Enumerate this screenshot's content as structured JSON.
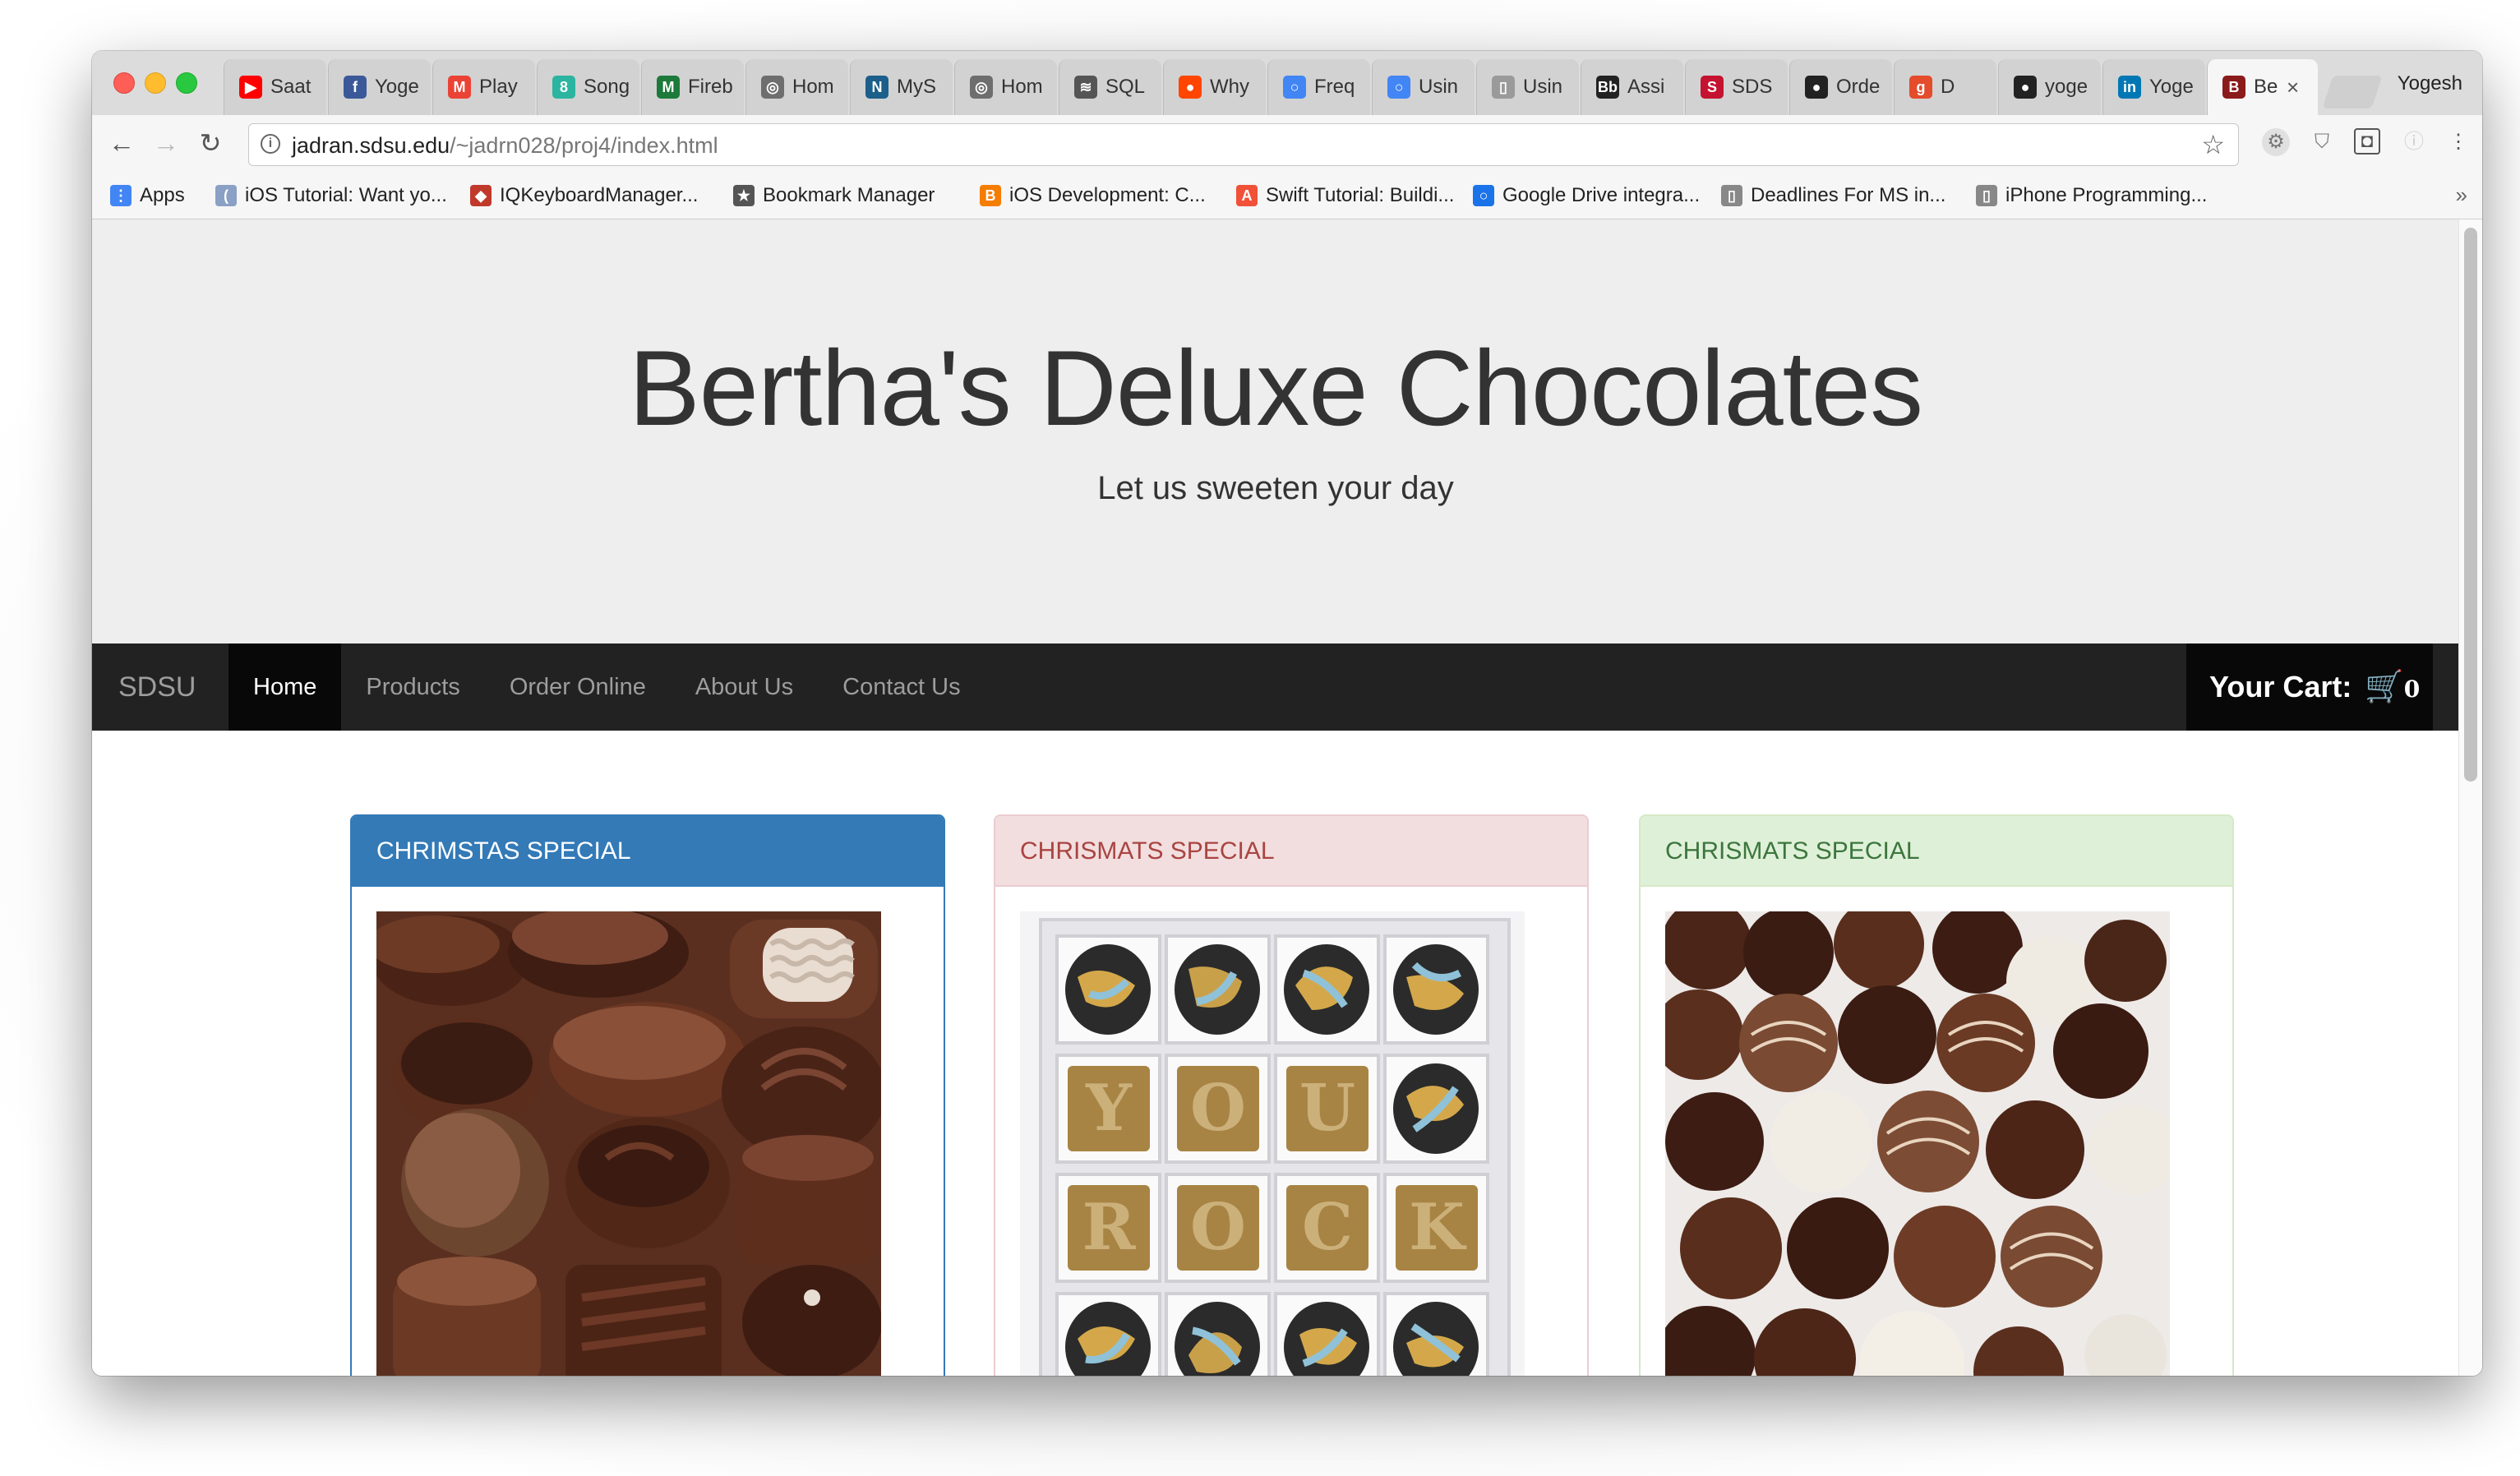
{
  "browser": {
    "profile_name": "Yogesh",
    "tabs": [
      {
        "label": "Saat",
        "icon": "youtube-icon",
        "color": "#ff0000",
        "glyph": "▶"
      },
      {
        "label": "Yoge",
        "icon": "facebook-icon",
        "color": "#3b5998",
        "glyph": "f"
      },
      {
        "label": "Play",
        "icon": "gmail-icon",
        "color": "#ea4335",
        "glyph": "M"
      },
      {
        "label": "Song",
        "icon": "song-icon",
        "color": "#2bb5a0",
        "glyph": "8"
      },
      {
        "label": "Fireb",
        "icon": "firebase-icon",
        "color": "#1d7a3a",
        "glyph": "M"
      },
      {
        "label": "Hom",
        "icon": "github-octocat-icon",
        "color": "#6e6e6e",
        "glyph": "◎"
      },
      {
        "label": "MyS",
        "icon": "mysql-icon",
        "color": "#1b5f8a",
        "glyph": "N"
      },
      {
        "label": "Hom",
        "icon": "gear-icon",
        "color": "#6e6e6e",
        "glyph": "◎"
      },
      {
        "label": "SQL",
        "icon": "stack-icon",
        "color": "#555555",
        "glyph": "≋"
      },
      {
        "label": "Why",
        "icon": "reddit-icon",
        "color": "#ff4500",
        "glyph": "●"
      },
      {
        "label": "Freq",
        "icon": "google-icon",
        "color": "#4285f4",
        "glyph": "○"
      },
      {
        "label": "Usin",
        "icon": "google-icon",
        "color": "#4285f4",
        "glyph": "○"
      },
      {
        "label": "Usin",
        "icon": "document-icon",
        "color": "#9a9a9a",
        "glyph": "▯"
      },
      {
        "label": "Assi",
        "icon": "bb-icon",
        "color": "#222222",
        "glyph": "Bb"
      },
      {
        "label": "SDS",
        "icon": "sdsu-icon",
        "color": "#c41230",
        "glyph": "S"
      },
      {
        "label": "Orde",
        "icon": "github-icon",
        "color": "#222222",
        "glyph": "●"
      },
      {
        "label": "D",
        "icon": "g-icon",
        "color": "#e44c2c",
        "glyph": "g"
      },
      {
        "label": "yoge",
        "icon": "github-icon",
        "color": "#222222",
        "glyph": "●"
      },
      {
        "label": "Yoge",
        "icon": "linkedin-icon",
        "color": "#0077b5",
        "glyph": "in"
      },
      {
        "label": "Be",
        "icon": "bertha-icon",
        "color": "#8b1a1a",
        "glyph": "B"
      }
    ],
    "url_host": "jadran.sdsu.edu",
    "url_path": "/~jadrn028/proj4/index.html",
    "bookmarks": [
      {
        "label": "Apps",
        "icon": "apps-grid-icon",
        "color": "#4285f4",
        "glyph": "⋮"
      },
      {
        "label": "iOS Tutorial: Want yo...",
        "icon": "ios-tutorial-icon",
        "color": "#8aa0c4",
        "glyph": "("
      },
      {
        "label": "IQKeyboardManager...",
        "icon": "iqkeyboard-icon",
        "color": "#c0392b",
        "glyph": "◆"
      },
      {
        "label": "Bookmark Manager",
        "icon": "star-icon",
        "color": "#555555",
        "glyph": "★"
      },
      {
        "label": "iOS Development: C...",
        "icon": "blogger-icon",
        "color": "#f57d00",
        "glyph": "B"
      },
      {
        "label": "Swift Tutorial: Buildi...",
        "icon": "swift-icon",
        "color": "#f05138",
        "glyph": "A"
      },
      {
        "label": "Google Drive integra...",
        "icon": "circle-icon",
        "color": "#1a73e8",
        "glyph": "○"
      },
      {
        "label": "Deadlines For MS in...",
        "icon": "document-icon",
        "color": "#888888",
        "glyph": "▯"
      },
      {
        "label": "iPhone Programming...",
        "icon": "document-icon",
        "color": "#888888",
        "glyph": "▯"
      }
    ]
  },
  "site": {
    "title": "Bertha's Deluxe Chocolates",
    "tagline": "Let us sweeten your day",
    "brand": "SDSU",
    "nav": [
      "Home",
      "Products",
      "Order Online",
      "About Us",
      "Contact Us"
    ],
    "active_nav": "Home",
    "cart_label": "Your Cart:",
    "cart_count": "0",
    "panels": [
      {
        "heading": "CHRIMSTAS SPECIAL",
        "style": "primary"
      },
      {
        "heading": "CHRISMATS SPECIAL",
        "style": "danger",
        "letters": [
          "Y",
          "O",
          "U",
          "R",
          "O",
          "C",
          "K"
        ]
      },
      {
        "heading": "CHRISMATS SPECIAL",
        "style": "success"
      }
    ]
  }
}
